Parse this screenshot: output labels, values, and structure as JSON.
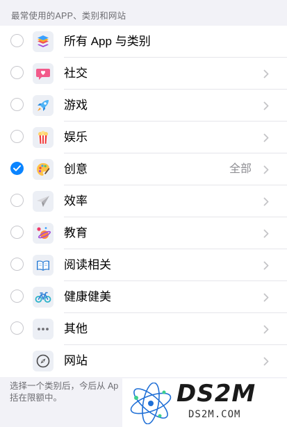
{
  "section_header": "最常使用的APP、类别和网站",
  "rows": [
    {
      "label": "所有 App 与类别",
      "icon": "stack-layers-icon",
      "value": "",
      "checked": false,
      "chevron": false,
      "radio": true
    },
    {
      "label": "社交",
      "icon": "chat-heart-icon",
      "value": "",
      "checked": false,
      "chevron": true,
      "radio": true
    },
    {
      "label": "游戏",
      "icon": "rocket-icon",
      "value": "",
      "checked": false,
      "chevron": true,
      "radio": true
    },
    {
      "label": "娱乐",
      "icon": "popcorn-icon",
      "value": "",
      "checked": false,
      "chevron": true,
      "radio": true
    },
    {
      "label": "创意",
      "icon": "palette-icon",
      "value": "全部",
      "checked": true,
      "chevron": true,
      "radio": true
    },
    {
      "label": "效率",
      "icon": "paper-plane-icon",
      "value": "",
      "checked": false,
      "chevron": true,
      "radio": true
    },
    {
      "label": "教育",
      "icon": "planet-icon",
      "value": "",
      "checked": false,
      "chevron": true,
      "radio": true
    },
    {
      "label": "阅读相关",
      "icon": "open-book-icon",
      "value": "",
      "checked": false,
      "chevron": true,
      "radio": true
    },
    {
      "label": "健康健美",
      "icon": "bicycle-icon",
      "value": "",
      "checked": false,
      "chevron": true,
      "radio": true
    },
    {
      "label": "其他",
      "icon": "ellipsis-icon",
      "value": "",
      "checked": false,
      "chevron": true,
      "radio": true
    },
    {
      "label": "网站",
      "icon": "compass-icon",
      "value": "",
      "checked": false,
      "chevron": true,
      "radio": false
    }
  ],
  "footer_line1": "选择一个类别后，今后从 Ap",
  "footer_line2": "括在限额中。",
  "watermark": {
    "big": "DS2M",
    "small": "DS2M.COM"
  },
  "colors": {
    "accent": "#0a84ff",
    "background": "#f2f2f7"
  }
}
